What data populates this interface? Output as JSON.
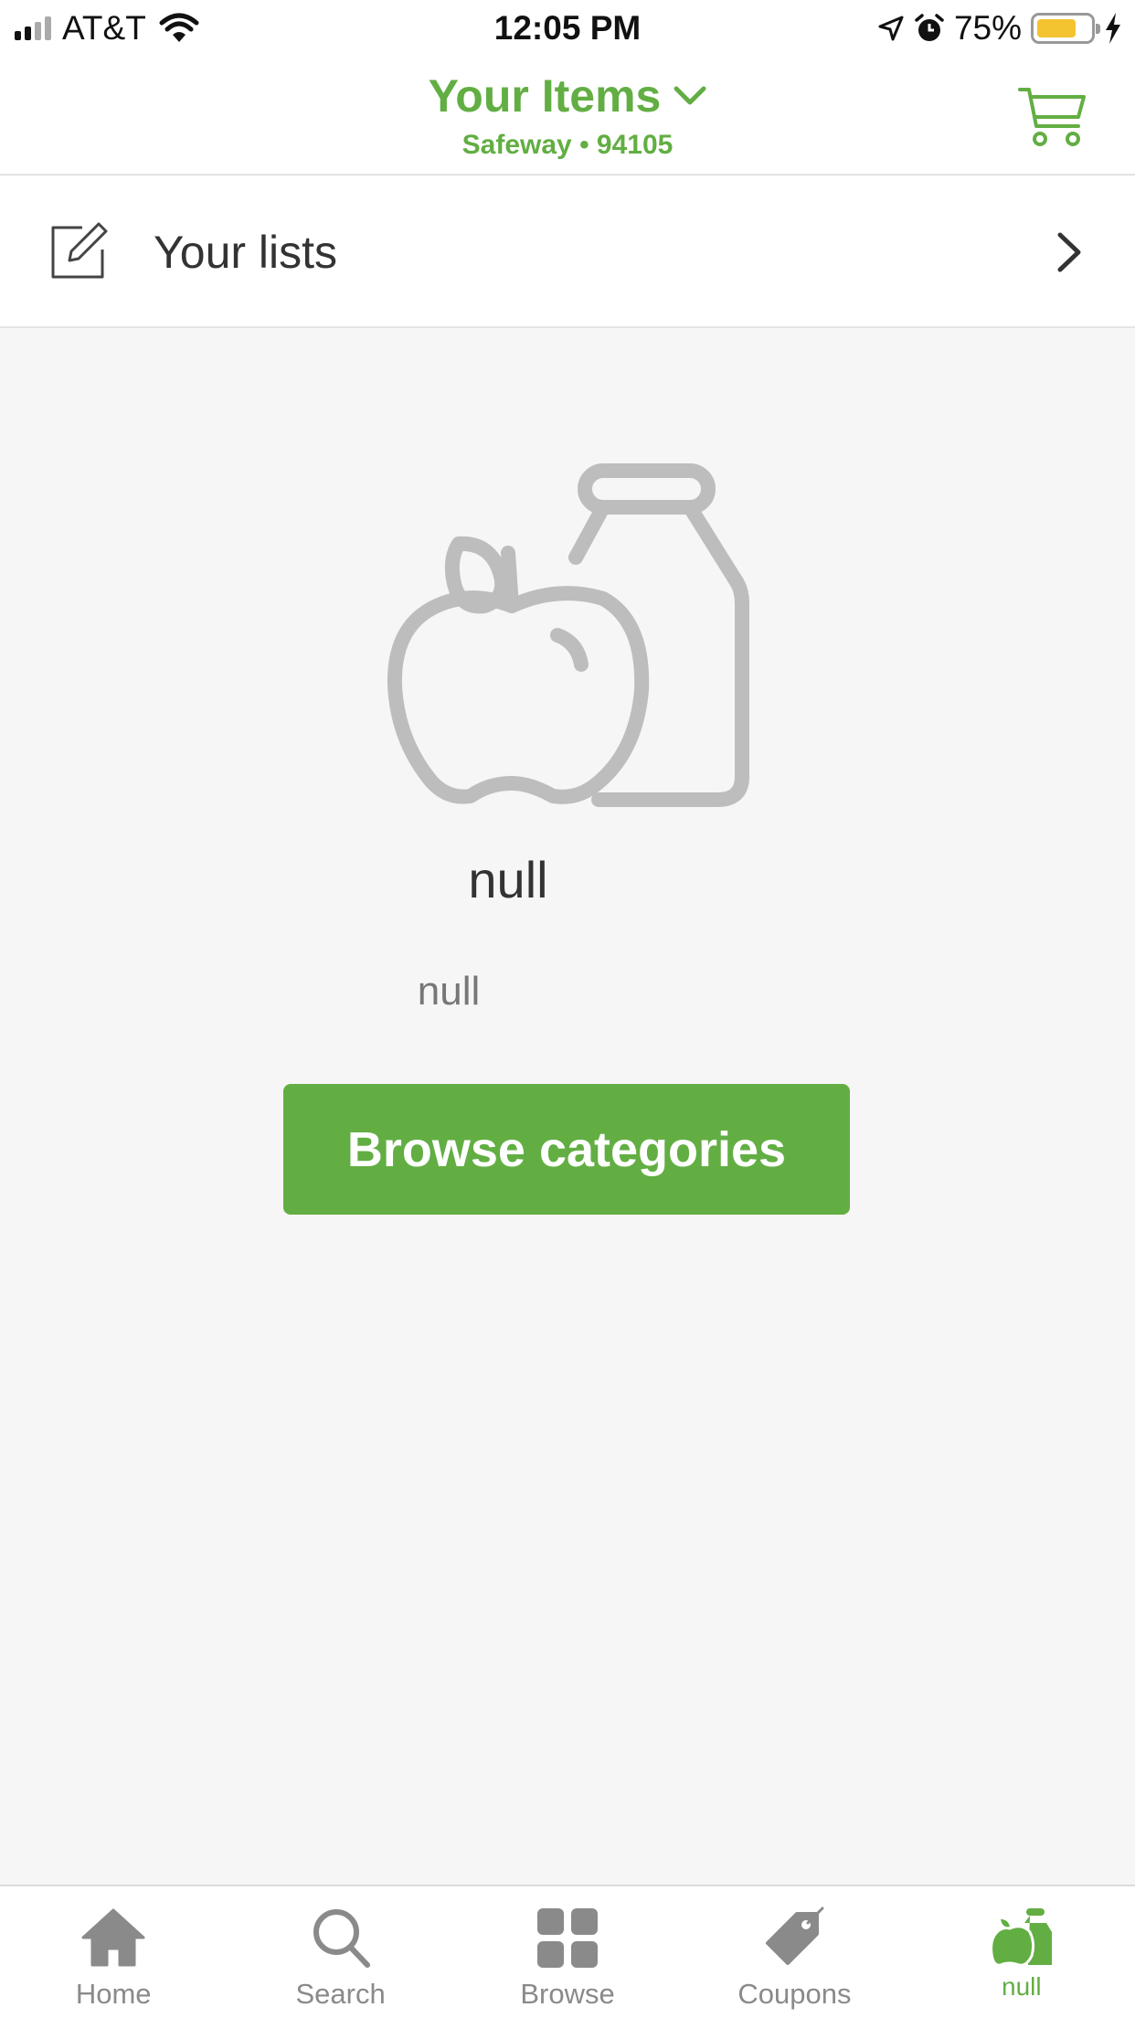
{
  "status_bar": {
    "carrier": "AT&T",
    "time": "12:05 PM",
    "battery_percent": "75%",
    "battery_level": 0.75,
    "signal_bars_filled": 2,
    "signal_bars_total": 4
  },
  "header": {
    "title": "Your Items",
    "store": "Safeway • 94105"
  },
  "lists_row": {
    "label": "Your lists"
  },
  "empty_state": {
    "title": "null",
    "subtitle": "null",
    "button_label": "Browse categories"
  },
  "tab_bar": {
    "tabs": [
      {
        "label": "Home",
        "icon": "home-icon",
        "active": false
      },
      {
        "label": "Search",
        "icon": "search-icon",
        "active": false
      },
      {
        "label": "Browse",
        "icon": "grid-icon",
        "active": false
      },
      {
        "label": "Coupons",
        "icon": "tag-icon",
        "active": false
      },
      {
        "label": "null",
        "icon": "apple-bottle-icon",
        "active": true
      }
    ]
  },
  "colors": {
    "accent": "#62ae43",
    "background": "#f6f6f6",
    "icon_gray": "#bdbdbd",
    "tab_inactive": "#8a8a8a",
    "battery": "#f4c430"
  }
}
